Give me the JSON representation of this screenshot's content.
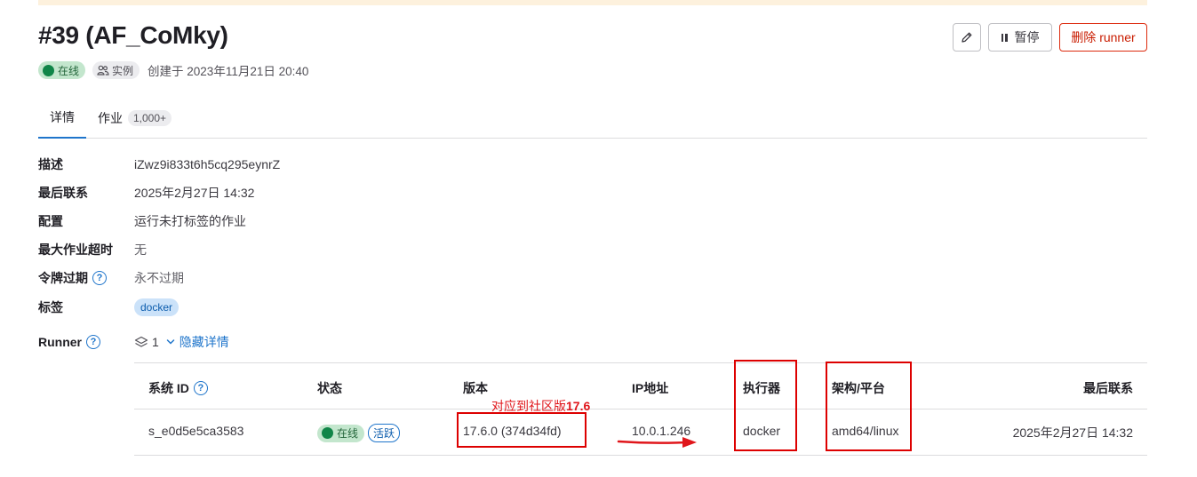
{
  "header": {
    "title": "#39 (AF_CoMky)",
    "status": "在线",
    "type": "实例",
    "created": "创建于 2023年11月21日 20:40",
    "pause_label": "暂停",
    "delete_label": "删除 runner"
  },
  "tabs": [
    {
      "label": "详情"
    },
    {
      "label": "作业",
      "count": "1,000+"
    }
  ],
  "details": {
    "description": {
      "label": "描述",
      "value": "iZwz9i833t6h5cq295eynrZ"
    },
    "last_contact": {
      "label": "最后联系",
      "value": "2025年2月27日 14:32"
    },
    "config": {
      "label": "配置",
      "value": "运行未打标签的作业"
    },
    "timeout": {
      "label": "最大作业超时",
      "value": "无"
    },
    "token_expiry": {
      "label": "令牌过期",
      "value": "永不过期"
    },
    "tags": {
      "label": "标签",
      "value": "docker"
    },
    "runner": {
      "label": "Runner",
      "count": "1",
      "toggle": "隐藏详情"
    }
  },
  "managers_table": {
    "columns": [
      "系统 ID",
      "状态",
      "版本",
      "IP地址",
      "执行器",
      "架构/平台",
      "最后联系"
    ],
    "rows": [
      {
        "system_id": "s_e0d5e5ca3583",
        "status": "在线",
        "activity": "活跃",
        "version": "17.6.0 (374d34fd)",
        "ip": "10.0.1.246",
        "executor": "docker",
        "arch": "amd64/linux",
        "last_contact": "2025年2月27日 14:32"
      }
    ]
  },
  "annotation": {
    "text": "对应到社区版",
    "bold": "17.6",
    "color": "#dd0000"
  },
  "colors": {
    "accent": "#1f75cb",
    "success": "#108548",
    "danger": "#dd2b0e"
  }
}
